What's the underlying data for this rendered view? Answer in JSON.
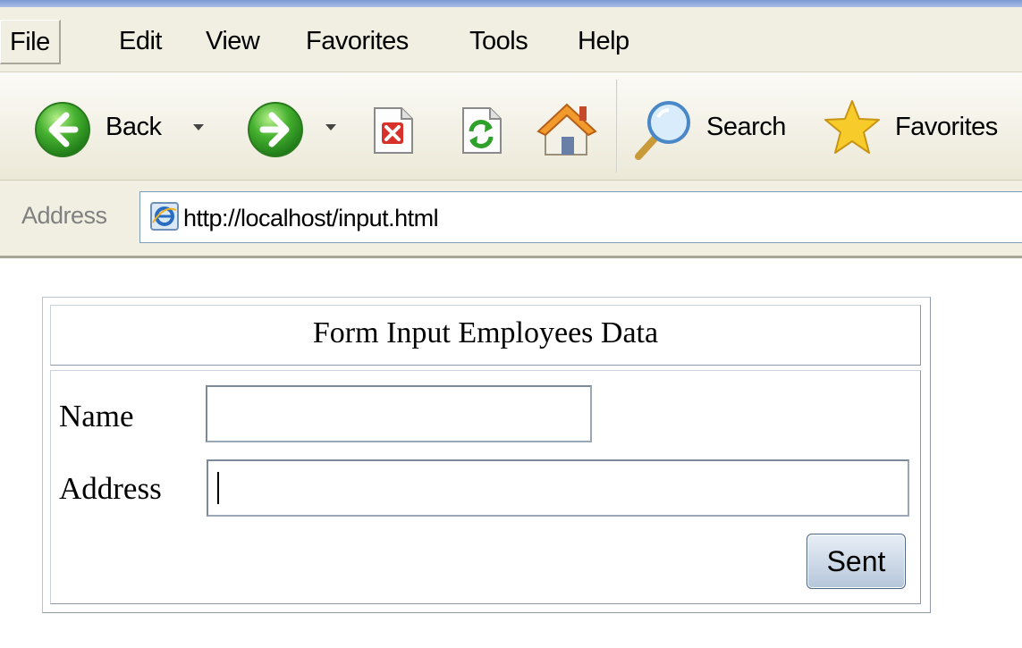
{
  "menu": {
    "items": [
      "File",
      "Edit",
      "View",
      "Favorites",
      "Tools",
      "Help"
    ]
  },
  "toolbar": {
    "back_label": "Back",
    "search_label": "Search",
    "favorites_label": "Favorites"
  },
  "address_bar": {
    "label": "Address",
    "url": "http://localhost/input.html"
  },
  "form": {
    "title": "Form Input Employees Data",
    "name_label": "Name",
    "name_value": "",
    "address_label": "Address",
    "address_value": "",
    "submit_label": "Sent"
  },
  "icons": {
    "back": "back-arrow-icon",
    "forward": "forward-arrow-icon",
    "stop": "stop-icon",
    "refresh": "refresh-icon",
    "home": "home-icon",
    "search": "search-icon",
    "favorites": "favorites-star-icon",
    "page": "ie-page-icon"
  },
  "colors": {
    "nav_green": "#3aa42a",
    "stop_red": "#d0302a",
    "star_yellow": "#f6c821",
    "menu_bg": "#f1efe2"
  }
}
